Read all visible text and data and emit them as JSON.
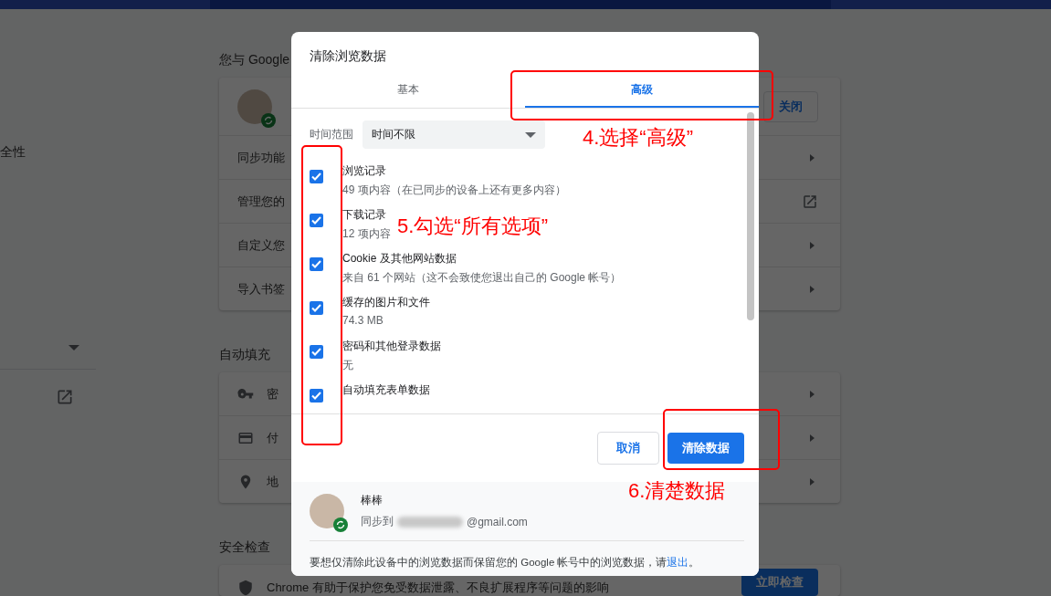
{
  "left_nav": {
    "items": [
      {
        "kind": "text",
        "label": "全性"
      },
      {
        "kind": "dropdown"
      },
      {
        "kind": "external"
      }
    ]
  },
  "sections": [
    {
      "title": "您与 Google",
      "rows": [
        {
          "kind": "profile",
          "action": "关闭"
        },
        {
          "kind": "arrow",
          "label": "同步功能"
        },
        {
          "kind": "external",
          "label": "管理您的"
        },
        {
          "kind": "arrow",
          "label": "自定义您"
        },
        {
          "kind": "arrow",
          "label": "导入书签"
        }
      ]
    },
    {
      "title": "自动填充",
      "rows": [
        {
          "kind": "arrow",
          "label": "密"
        },
        {
          "kind": "arrow",
          "label": "付"
        },
        {
          "kind": "arrow",
          "label": "地"
        }
      ]
    },
    {
      "title": "安全检查",
      "rows": [
        {
          "kind": "action",
          "label": "Chrome 有助于保护您免受数据泄露、不良扩展程序等问题的影响",
          "action": "立即检查"
        }
      ]
    }
  ],
  "dialog": {
    "title": "清除浏览数据",
    "tabs": [
      {
        "label": "基本",
        "selected": false
      },
      {
        "label": "高级",
        "selected": true
      }
    ],
    "time_range": {
      "label": "时间范围",
      "value": "时间不限"
    },
    "items": [
      {
        "label": "浏览记录",
        "detail": "49 项内容（在已同步的设备上还有更多内容）",
        "checked": true
      },
      {
        "label": "下载记录",
        "detail": "12 项内容",
        "checked": true
      },
      {
        "label": "Cookie 及其他网站数据",
        "detail": "来自 61 个网站（这不会致使您退出自己的 Google 帐号）",
        "checked": true
      },
      {
        "label": "缓存的图片和文件",
        "detail": "74.3 MB",
        "checked": true
      },
      {
        "label": "密码和其他登录数据",
        "detail": "无",
        "checked": true
      },
      {
        "label": "自动填充表单数据",
        "checked": true
      }
    ],
    "buttons": [
      {
        "kind": "secondary",
        "label": "取消"
      },
      {
        "kind": "primary",
        "label": "清除数据"
      }
    ],
    "account": {
      "name": "棒棒",
      "sync_prefix": "同步到",
      "email_suffix": "@gmail.com"
    },
    "note": {
      "text": "要想仅清除此设备中的浏览数据而保留您的 Google 帐号中的浏览数据，请",
      "link": "退出",
      "end": "。"
    }
  },
  "annotations": [
    {
      "kind": "frame"
    },
    {
      "kind": "label",
      "text": "4.选择“高级”"
    },
    {
      "kind": "frame"
    },
    {
      "kind": "label",
      "text": "5.勾选“所有选项”"
    },
    {
      "kind": "frame"
    },
    {
      "kind": "label",
      "text": "6.清楚数据"
    }
  ]
}
